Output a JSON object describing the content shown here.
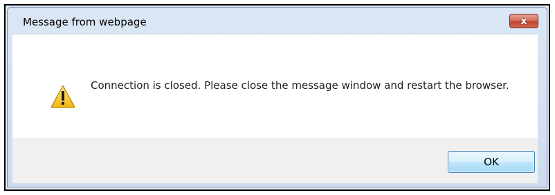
{
  "window": {
    "title": "Message from webpage",
    "close_label": "x"
  },
  "content": {
    "icon": "warning-icon",
    "message": "Connection is closed. Please close the message window and restart the browser."
  },
  "footer": {
    "ok_label": "OK"
  },
  "colors": {
    "close_button": "#c0452f",
    "ok_button_border": "#3c7fb1",
    "warning_yellow": "#f7c631"
  }
}
